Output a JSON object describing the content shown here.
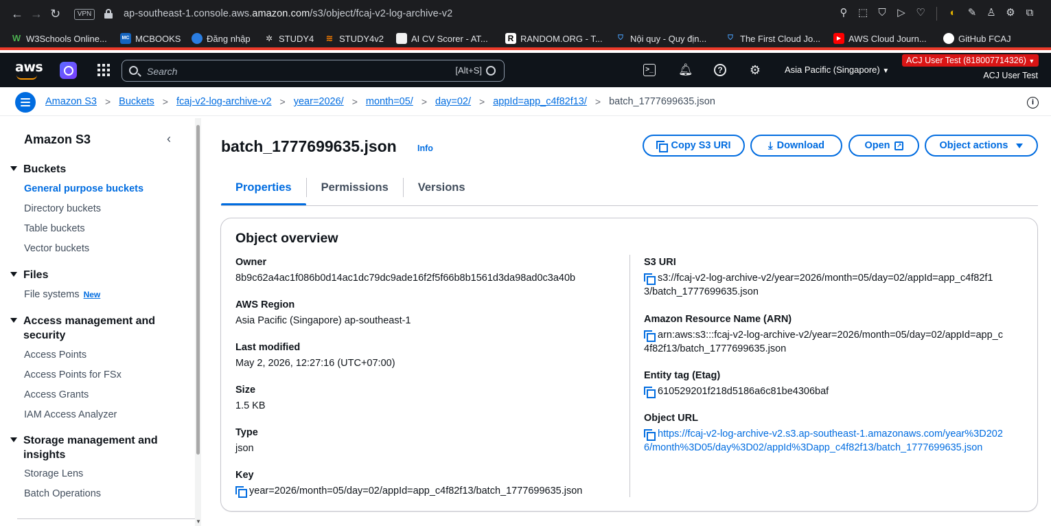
{
  "browser": {
    "url_prefix": "ap-southeast-1.console.aws.",
    "url_domain": "amazon.com",
    "url_path": "/s3/object/fcaj-v2-log-archive-v2",
    "vpn_label": "VPN",
    "bookmarks": [
      {
        "label": "W3Schools Online...",
        "icon": "w3schools-icon"
      },
      {
        "label": "MCBOOKS",
        "icon": "mcbooks-icon"
      },
      {
        "label": "Đăng nhập",
        "icon": "globe-icon"
      },
      {
        "label": "STUDY4",
        "icon": "study4-icon"
      },
      {
        "label": "STUDY4v2",
        "icon": "study4v2-icon"
      },
      {
        "label": "AI CV Scorer - AT...",
        "icon": "cv-icon"
      },
      {
        "label": "RANDOM.ORG - T...",
        "icon": "random-icon"
      },
      {
        "label": "Nội quy - Quy địn...",
        "icon": "shield-icon"
      },
      {
        "label": "The First Cloud Jo...",
        "icon": "shield-icon"
      },
      {
        "label": "AWS Cloud Journ...",
        "icon": "youtube-icon"
      },
      {
        "label": "GitHub FCAJ",
        "icon": "github-icon"
      }
    ]
  },
  "aws_nav": {
    "logo": "aws",
    "search_placeholder": "Search",
    "search_shortcut": "[Alt+S]",
    "region": "Asia Pacific (Singapore)",
    "account_badge": "ACJ User Test (818007714326)",
    "user": "ACJ User Test"
  },
  "breadcrumb": {
    "items": [
      "Amazon S3",
      "Buckets",
      "fcaj-v2-log-archive-v2",
      "year=2026/",
      "month=05/",
      "day=02/",
      "appId=app_c4f82f13/"
    ],
    "current": "batch_1777699635.json"
  },
  "sidebar": {
    "title": "Amazon S3",
    "sections": [
      {
        "label": "Buckets",
        "items": [
          "General purpose buckets",
          "Directory buckets",
          "Table buckets",
          "Vector buckets"
        ]
      },
      {
        "label": "Files",
        "items": [
          "File systems"
        ],
        "badge": "New"
      },
      {
        "label": "Access management and security",
        "items": [
          "Access Points",
          "Access Points for FSx",
          "Access Grants",
          "IAM Access Analyzer"
        ]
      },
      {
        "label": "Storage management and insights",
        "items": [
          "Storage Lens",
          "Batch Operations"
        ]
      }
    ]
  },
  "object": {
    "title": "batch_1777699635.json",
    "info": "Info",
    "buttons": {
      "copy_uri": "Copy S3 URI",
      "download": "Download",
      "open": "Open",
      "actions": "Object actions"
    },
    "tabs": [
      "Properties",
      "Permissions",
      "Versions"
    ],
    "active_tab": "Properties"
  },
  "overview": {
    "heading": "Object overview",
    "owner_label": "Owner",
    "owner": "8b9c62a4ac1f086b0d14ac1dc79dc9ade16f2f5f66b8b1561d3da98ad0c3a40b",
    "region_label": "AWS Region",
    "region": "Asia Pacific (Singapore) ap-southeast-1",
    "modified_label": "Last modified",
    "modified": "May 2, 2026, 12:27:16 (UTC+07:00)",
    "size_label": "Size",
    "size": "1.5 KB",
    "type_label": "Type",
    "type": "json",
    "key_label": "Key",
    "key": "year=2026/month=05/day=02/appId=app_c4f82f13/batch_1777699635.json",
    "s3uri_label": "S3 URI",
    "s3uri_line1": "s3://fcaj-v2-log-archive-v2/year=2026/month=05/day=02/appId=app_c4f82f1",
    "s3uri_line2": "3/batch_1777699635.json",
    "arn_label": "Amazon Resource Name (ARN)",
    "arn_line1": "arn:aws:s3:::fcaj-v2-log-archive-v2/year=2026/month=05/day=02/appId=app_c",
    "arn_line2": "4f82f13/batch_1777699635.json",
    "etag_label": "Entity tag (Etag)",
    "etag": "610529201f218d5186a6c81be4306baf",
    "url_label": "Object URL",
    "url_line1": "https://fcaj-v2-log-archive-v2.s3.ap-southeast-1.amazonaws.com/year%3D202",
    "url_line2": "6/month%3D05/day%3D02/appId%3Dapp_c4f82f13/batch_1777699635.json"
  }
}
